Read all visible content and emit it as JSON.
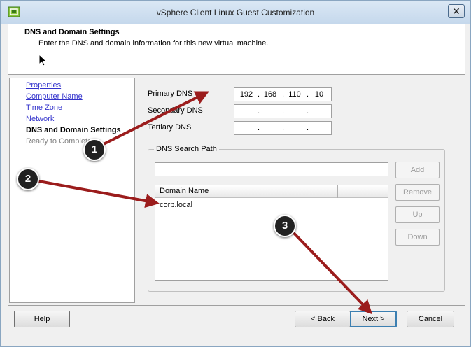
{
  "window": {
    "title": "vSphere Client Linux Guest Customization",
    "close_glyph": "✕"
  },
  "header": {
    "title": "DNS and Domain Settings",
    "description": "Enter the DNS and domain information for this new virtual machine."
  },
  "nav": {
    "items": [
      {
        "label": "Properties",
        "state": "link"
      },
      {
        "label": "Computer Name",
        "state": "link"
      },
      {
        "label": "Time Zone",
        "state": "link"
      },
      {
        "label": "Network",
        "state": "link"
      },
      {
        "label": "DNS and Domain Settings",
        "state": "current"
      },
      {
        "label": "Ready to Complete",
        "state": "disabled"
      }
    ]
  },
  "dns": {
    "primary": {
      "label": "Primary DNS",
      "octets": [
        "192",
        "168",
        "110",
        "10"
      ]
    },
    "secondary": {
      "label": "Secondary DNS",
      "octets": [
        "",
        "",
        "",
        ""
      ]
    },
    "tertiary": {
      "label": "Tertiary DNS",
      "octets": [
        "",
        "",
        "",
        ""
      ]
    }
  },
  "search_path": {
    "legend": "DNS Search Path",
    "input_value": "",
    "column_header": "Domain Name",
    "rows": [
      "corp.local"
    ],
    "buttons": {
      "add": "Add",
      "remove": "Remove",
      "up": "Up",
      "down": "Down"
    }
  },
  "footer": {
    "help": "Help",
    "back": "< Back",
    "next": "Next >",
    "cancel": "Cancel"
  },
  "annotations": {
    "badges": [
      "1",
      "2",
      "3"
    ],
    "arrow_color": "#9b1c1c"
  }
}
